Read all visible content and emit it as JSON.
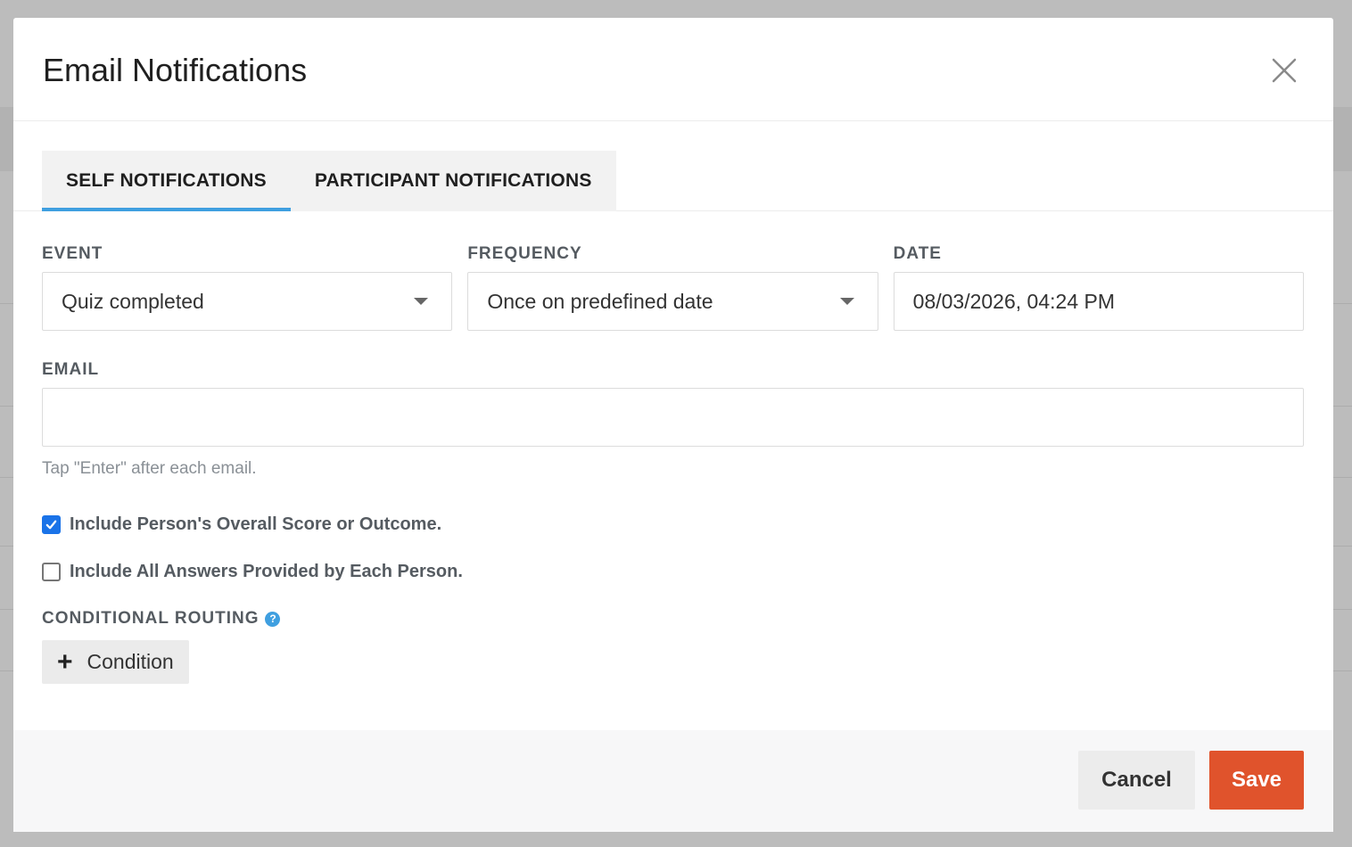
{
  "modal": {
    "title": "Email Notifications"
  },
  "tabs": [
    {
      "label": "SELF NOTIFICATIONS",
      "active": true
    },
    {
      "label": "PARTICIPANT NOTIFICATIONS",
      "active": false
    }
  ],
  "fields": {
    "event": {
      "label": "EVENT",
      "value": "Quiz completed"
    },
    "frequency": {
      "label": "FREQUENCY",
      "value": "Once on predefined date"
    },
    "date": {
      "label": "DATE",
      "value": "08/03/2026, 04:24 PM"
    },
    "email": {
      "label": "EMAIL",
      "value": "",
      "hint": "Tap \"Enter\" after each email."
    }
  },
  "options": [
    {
      "label": "Include Person's Overall Score or Outcome.",
      "checked": true
    },
    {
      "label": "Include All Answers Provided by Each Person.",
      "checked": false
    }
  ],
  "routing": {
    "label": "CONDITIONAL ROUTING",
    "help_icon": "?",
    "add_label": "Condition"
  },
  "footer": {
    "cancel_label": "Cancel",
    "save_label": "Save"
  },
  "colors": {
    "accent": "#3f9fe0",
    "save": "#e0532c",
    "checkbox": "#1a73e8"
  }
}
